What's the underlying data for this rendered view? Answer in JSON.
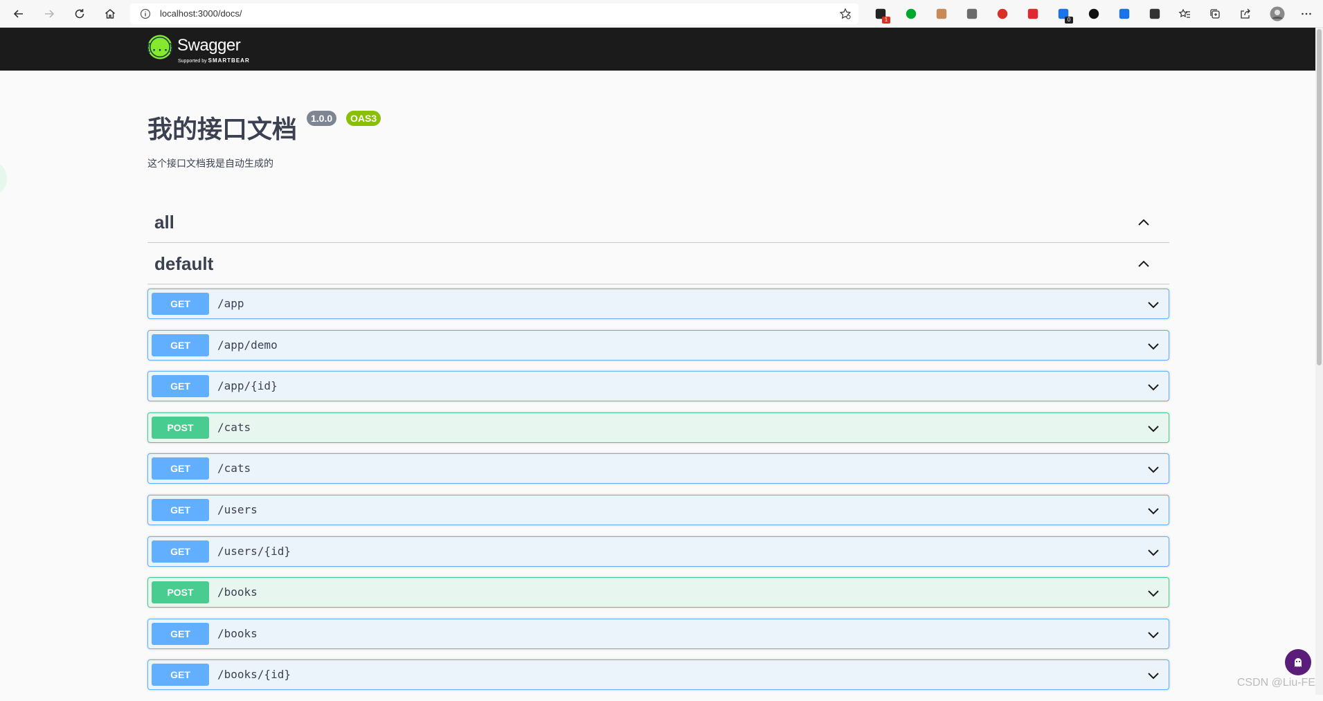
{
  "browser": {
    "url": "localhost:3000/docs/",
    "extension_icons": [
      {
        "name": "tab-manager-extension-icon",
        "color": "#222222",
        "badge": "1",
        "badge_color": "#d93025"
      },
      {
        "name": "evernote-extension-icon",
        "color": "#00a82d",
        "badge": "",
        "badge_color": ""
      },
      {
        "name": "avatar-extension-icon",
        "color": "#c98a5a",
        "badge": "",
        "badge_color": ""
      },
      {
        "name": "grammar-extension-icon",
        "color": "#6b6b6b",
        "badge": "",
        "badge_color": ""
      },
      {
        "name": "speed-extension-icon",
        "color": "#d93025",
        "badge": "",
        "badge_color": ""
      },
      {
        "name": "adblock-plus-extension-icon",
        "color": "#e0282e",
        "badge": "",
        "badge_color": ""
      },
      {
        "name": "translate-extension-icon",
        "color": "#1a73e8",
        "badge": "0",
        "badge_color": "#222222"
      },
      {
        "name": "dark-extension-icon",
        "color": "#111111",
        "badge": "",
        "badge_color": ""
      },
      {
        "name": "crop-extension-icon",
        "color": "#1a73e8",
        "badge": "",
        "badge_color": ""
      },
      {
        "name": "extensions-puzzle-icon",
        "color": "#333333",
        "badge": "",
        "badge_color": ""
      }
    ]
  },
  "topbar": {
    "logo_text": "Swagger",
    "logo_sub_prefix": "Supported by",
    "logo_sub_brand": "SMARTBEAR"
  },
  "info": {
    "title": "我的接口文档",
    "version": "1.0.0",
    "oas": "OAS3",
    "description": "这个接口文档我是自动生成的"
  },
  "tags": [
    {
      "name": "all"
    },
    {
      "name": "default"
    }
  ],
  "operations": [
    {
      "method": "GET",
      "path": "/app"
    },
    {
      "method": "GET",
      "path": "/app/demo"
    },
    {
      "method": "GET",
      "path": "/app/{id}"
    },
    {
      "method": "POST",
      "path": "/cats"
    },
    {
      "method": "GET",
      "path": "/cats"
    },
    {
      "method": "GET",
      "path": "/users"
    },
    {
      "method": "GET",
      "path": "/users/{id}"
    },
    {
      "method": "POST",
      "path": "/books"
    },
    {
      "method": "GET",
      "path": "/books"
    },
    {
      "method": "GET",
      "path": "/books/{id}"
    }
  ],
  "watermark": "CSDN @Liu-FE",
  "colors": {
    "get": "#61affe",
    "post": "#49cc90",
    "topbar": "#1b1b1b"
  }
}
